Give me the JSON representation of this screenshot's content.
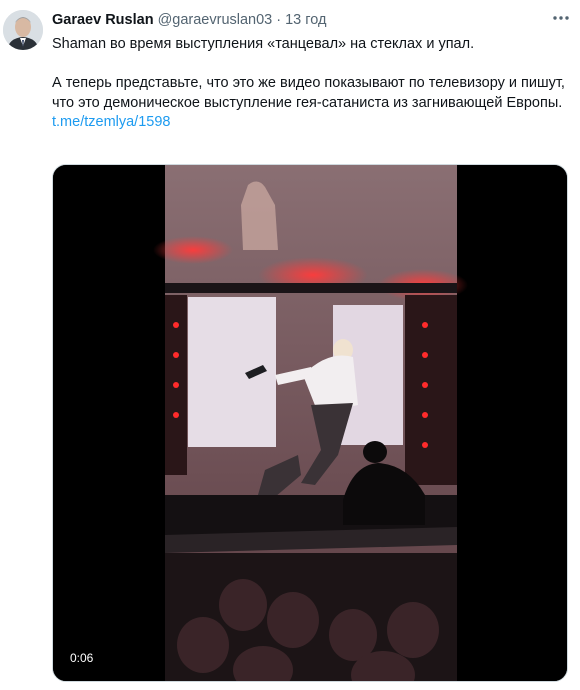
{
  "tweet": {
    "author_name": "Garaev Ruslan",
    "author_handle": "@garaevruslan03",
    "separator": "·",
    "timestamp": "13 год",
    "line1": "Shaman во время выступления «танцевал» на стеклах и упал.",
    "line2": "А теперь представьте, что это же видео показывают по телевизору и пишут, что это демоническое выступление гея-сатаниста из загнивающей Европы.",
    "link_text": "t.me/tzemlya/1598"
  },
  "video": {
    "duration": "0:06"
  },
  "icons": {
    "more": "more-horizontal-icon",
    "avatar": "user-avatar"
  },
  "colors": {
    "link": "#1d9bf0",
    "text": "#0f1419",
    "secondary": "#536471",
    "stage_red": "#e0192b"
  }
}
